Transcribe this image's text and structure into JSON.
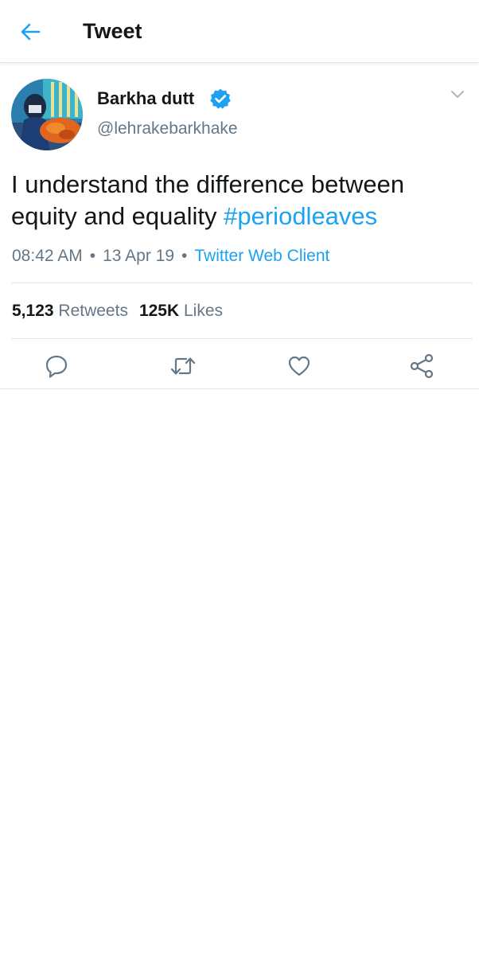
{
  "header": {
    "title": "Tweet",
    "back_icon": "arrow-left-icon"
  },
  "tweet": {
    "author": {
      "display_name": "Barkha dutt",
      "handle": "@lehrakebarkhake",
      "verified": true
    },
    "text_plain": "I understand the difference between equity and equality ",
    "hashtag": "#periodleaves",
    "time": "08:42 AM",
    "date": "13 Apr 19",
    "separator": "•",
    "client": "Twitter Web Client"
  },
  "stats": {
    "retweets_count": "5,123",
    "retweets_label": "Retweets",
    "likes_count": "125K",
    "likes_label": "Likes"
  },
  "actions": {
    "reply_icon": "reply-icon",
    "retweet_icon": "retweet-icon",
    "like_icon": "heart-icon",
    "share_icon": "share-icon"
  },
  "colors": {
    "accent": "#1da1f2",
    "secondary_text": "#657786",
    "primary_text": "#14171a",
    "divider": "#e1e8ed"
  }
}
